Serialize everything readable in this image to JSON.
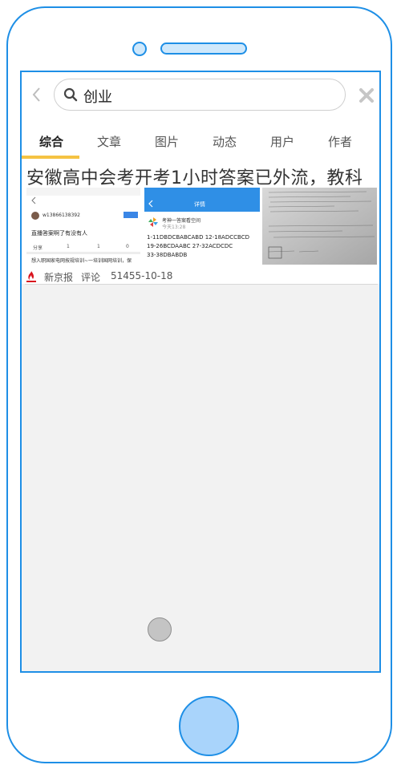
{
  "search": {
    "query": "创业"
  },
  "tabs": [
    {
      "label": "综合",
      "active": true
    },
    {
      "label": "文章"
    },
    {
      "label": "图片"
    },
    {
      "label": "动态"
    },
    {
      "label": "用户"
    },
    {
      "label": "作者"
    }
  ],
  "article": {
    "title": "安徽高中会考开考1小时答案已外流，教科",
    "source": "新京报",
    "comments_label": "评论",
    "date": "51455-10-18",
    "thumb1": {
      "user": "w13866138392",
      "caption": "直播答案啊了有没有人",
      "counts": [
        "分享",
        "1",
        "1",
        "0"
      ],
      "footer": "想入职国家电网按规培训~一培训国网培训，保"
    },
    "thumb2": {
      "header": "详情",
      "poster": "考神一答案看空间",
      "time": "今天13:28",
      "answers": [
        "1-11DBDCBABCABD  12-18ADCCBCD",
        "19-26BCDAABC  27-32ACDCDC",
        "33-38DBABDB"
      ]
    }
  },
  "colors": {
    "accent": "#f5c343",
    "frame": "#1e8fe6",
    "source_icon": "#d9141e"
  }
}
